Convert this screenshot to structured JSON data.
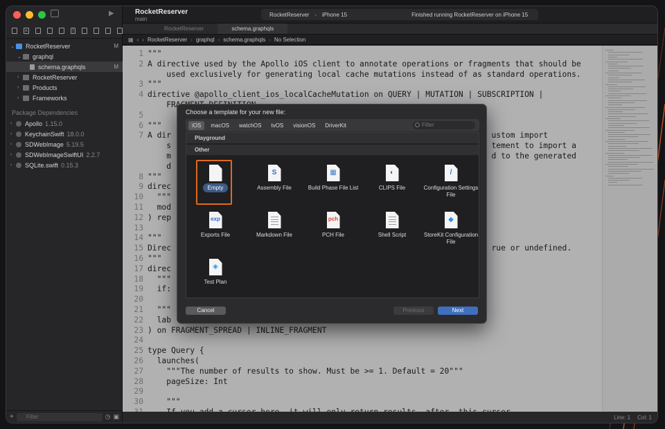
{
  "app": {
    "project_name": "RocketReserver",
    "branch": "main",
    "scheme_target": "RocketReserver",
    "device": "iPhone 15",
    "status": "Finished running RocketReserver on iPhone 15"
  },
  "tabs": [
    "RocketReserver",
    "schema.graphqls"
  ],
  "breadcrumbs": [
    "RocketReserver",
    "graphql",
    "schema.graphqls",
    "No Selection"
  ],
  "navigator": {
    "items": [
      {
        "label": "RocketReserver",
        "badge": "M",
        "icon_color": "#4a90e2"
      },
      {
        "label": "graphql",
        "badge": "",
        "icon_color": "#6d6d70"
      },
      {
        "label": "schema.graphqls",
        "badge": "M",
        "icon_color": "#9a9a9a"
      },
      {
        "label": "RocketReserver",
        "badge": "",
        "icon_color": "#6d6d70"
      },
      {
        "label": "Products",
        "badge": "",
        "icon_color": "#6d6d70"
      },
      {
        "label": "Frameworks",
        "badge": "",
        "icon_color": "#6d6d70"
      }
    ],
    "packages_title": "Package Dependencies",
    "packages": [
      {
        "name": "Apollo",
        "version": "1.15.0"
      },
      {
        "name": "KeychainSwift",
        "version": "18.0.0"
      },
      {
        "name": "SDWebImage",
        "version": "5.19.5"
      },
      {
        "name": "SDWebImageSwiftUI",
        "version": "2.2.7"
      },
      {
        "name": "SQLite.swift",
        "version": "0.15.3"
      }
    ],
    "filter_placeholder": "Filter"
  },
  "editor": {
    "lines": [
      {
        "n": "1",
        "t": "\"\"\""
      },
      {
        "n": "2",
        "t": "A directive used by the Apollo iOS client to annotate operations or fragments that should be"
      },
      {
        "n": "",
        "t": "    used exclusively for generating local cache mutations instead of as standard operations."
      },
      {
        "n": "3",
        "t": "\"\"\""
      },
      {
        "n": "4",
        "t": "directive @apollo_client_ios_localCacheMutation on QUERY | MUTATION | SUBSCRIPTION |"
      },
      {
        "n": "",
        "t": "    FRAGMENT_DEFINITION"
      },
      {
        "n": "5",
        "t": ""
      },
      {
        "n": "6",
        "t": "\"\"\""
      },
      {
        "n": "7",
        "t": "A dir                                                                    ustom import"
      },
      {
        "n": "",
        "t": "    s                                                                    tement to import a"
      },
      {
        "n": "",
        "t": "    m                                                                    d to the generated"
      },
      {
        "n": "",
        "t": "    d"
      },
      {
        "n": "8",
        "t": "\"\"\""
      },
      {
        "n": "9",
        "t": "direc"
      },
      {
        "n": "10",
        "t": "  \"\"\""
      },
      {
        "n": "11",
        "t": "  mod"
      },
      {
        "n": "12",
        "t": ") rep"
      },
      {
        "n": "13",
        "t": ""
      },
      {
        "n": "14",
        "t": "\"\"\""
      },
      {
        "n": "15",
        "t": "Direc                                                                    rue or undefined."
      },
      {
        "n": "16",
        "t": "\"\"\""
      },
      {
        "n": "17",
        "t": "direc"
      },
      {
        "n": "18",
        "t": "  \"\"\""
      },
      {
        "n": "19",
        "t": "  if:"
      },
      {
        "n": "20",
        "t": ""
      },
      {
        "n": "21",
        "t": "  \"\"\""
      },
      {
        "n": "22",
        "t": "  lab"
      },
      {
        "n": "23",
        "t": ") on FRAGMENT_SPREAD | INLINE_FRAGMENT"
      },
      {
        "n": "24",
        "t": ""
      },
      {
        "n": "25",
        "t": "type Query {"
      },
      {
        "n": "26",
        "t": "  launches("
      },
      {
        "n": "27",
        "t": "    \"\"\"The number of results to show. Must be >= 1. Default = 20\"\"\""
      },
      {
        "n": "28",
        "t": "    pageSize: Int"
      },
      {
        "n": "29",
        "t": ""
      },
      {
        "n": "30",
        "t": "    \"\"\""
      },
      {
        "n": "31",
        "t": "    If you add a cursor here, it will only return results _after_ this cursor"
      }
    ]
  },
  "statusbar": {
    "line": "Line: 1",
    "col": "Col: 1"
  },
  "dialog": {
    "title": "Choose a template for your new file:",
    "platforms": [
      "iOS",
      "macOS",
      "watchOS",
      "tvOS",
      "visionOS",
      "DriverKit"
    ],
    "active_platform": "iOS",
    "filter_placeholder": "Filter",
    "sections": [
      "Playground",
      "Other"
    ],
    "templates": [
      {
        "label": "Empty",
        "glyph": "",
        "glyph_color": "#3b78d8",
        "selected": true
      },
      {
        "label": "Assembly File",
        "glyph": "S",
        "glyph_color": "#2f6fd6"
      },
      {
        "label": "Build Phase File List",
        "glyph": "▦",
        "glyph_color": "#3b82d6"
      },
      {
        "label": "CLIPS File",
        "glyph": "◐",
        "glyph_color": "#2f6fd6"
      },
      {
        "label": "Configuration Settings File",
        "glyph": "/",
        "glyph_color": "#2f6fd6"
      },
      {
        "label": "Exports File",
        "glyph": "exp",
        "glyph_color": "#2f6fd6"
      },
      {
        "label": "Markdown File",
        "glyph": "",
        "glyph_color": "#777"
      },
      {
        "label": "PCH File",
        "glyph": "pch",
        "glyph_color": "#d9473a"
      },
      {
        "label": "Shell Script",
        "glyph": "",
        "glyph_color": "#777"
      },
      {
        "label": "StoreKit Configuration File",
        "glyph": "◆",
        "glyph_color": "#2f8fe0"
      },
      {
        "label": "Test Plan",
        "glyph": "◈",
        "glyph_color": "#2f8fe0"
      }
    ],
    "buttons": {
      "cancel": "Cancel",
      "previous": "Previous",
      "next": "Next"
    }
  }
}
